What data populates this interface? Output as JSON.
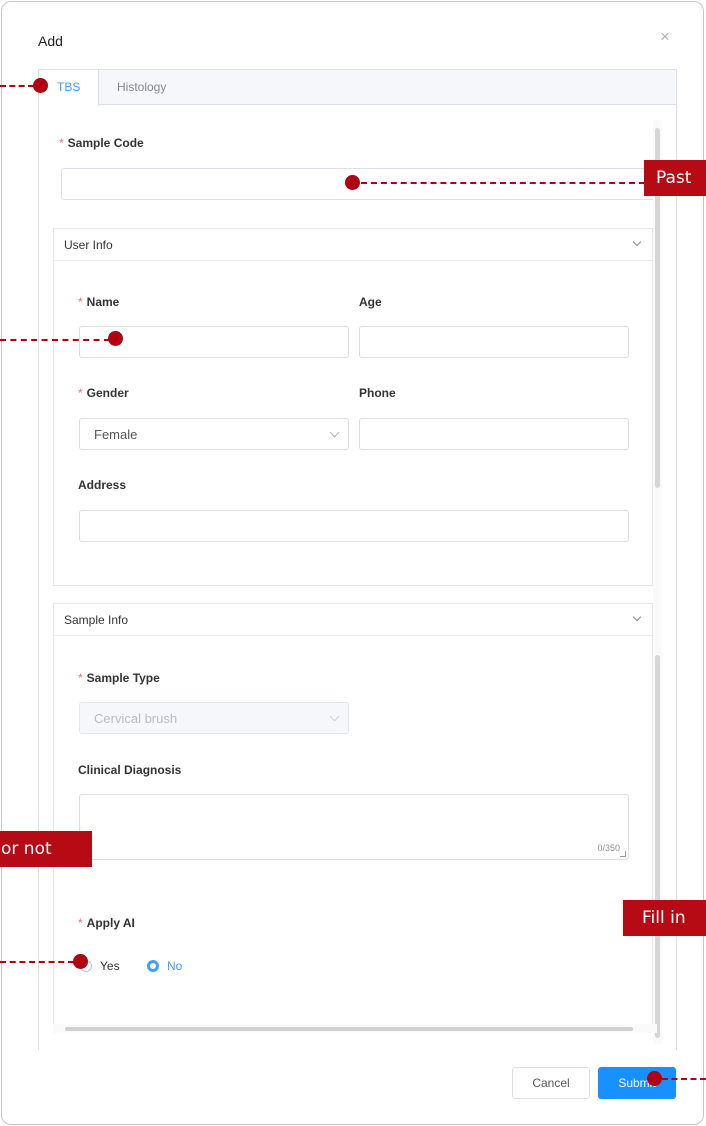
{
  "dialog": {
    "title": "Add",
    "close_glyph": "×"
  },
  "tabs": {
    "active": "TBS",
    "inactive": "Histology"
  },
  "form": {
    "sample_code_label": "Sample Code",
    "required_mark": "*",
    "user_info": {
      "title": "User Info",
      "name_label": "Name",
      "age_label": "Age",
      "gender_label": "Gender",
      "gender_value": "Female",
      "phone_label": "Phone",
      "address_label": "Address"
    },
    "sample_info": {
      "title": "Sample Info",
      "sample_type_label": "Sample Type",
      "sample_type_value": "Cervical brush",
      "clinical_label": "Clinical Diagnosis",
      "clinical_counter": "0/350",
      "apply_ai_label": "Apply AI",
      "option_yes": "Yes",
      "option_no": "No",
      "selected_option": "No"
    }
  },
  "buttons": {
    "cancel": "Cancel",
    "submit": "Submit"
  },
  "annotations": {
    "paste_text": "Past",
    "or_not_text": "or not",
    "fill_text": "Fill in",
    "color": "#b00012"
  },
  "theme": {
    "accent": "#409eff",
    "submit_bg": "#1890ff",
    "required": "#f56c6c"
  }
}
